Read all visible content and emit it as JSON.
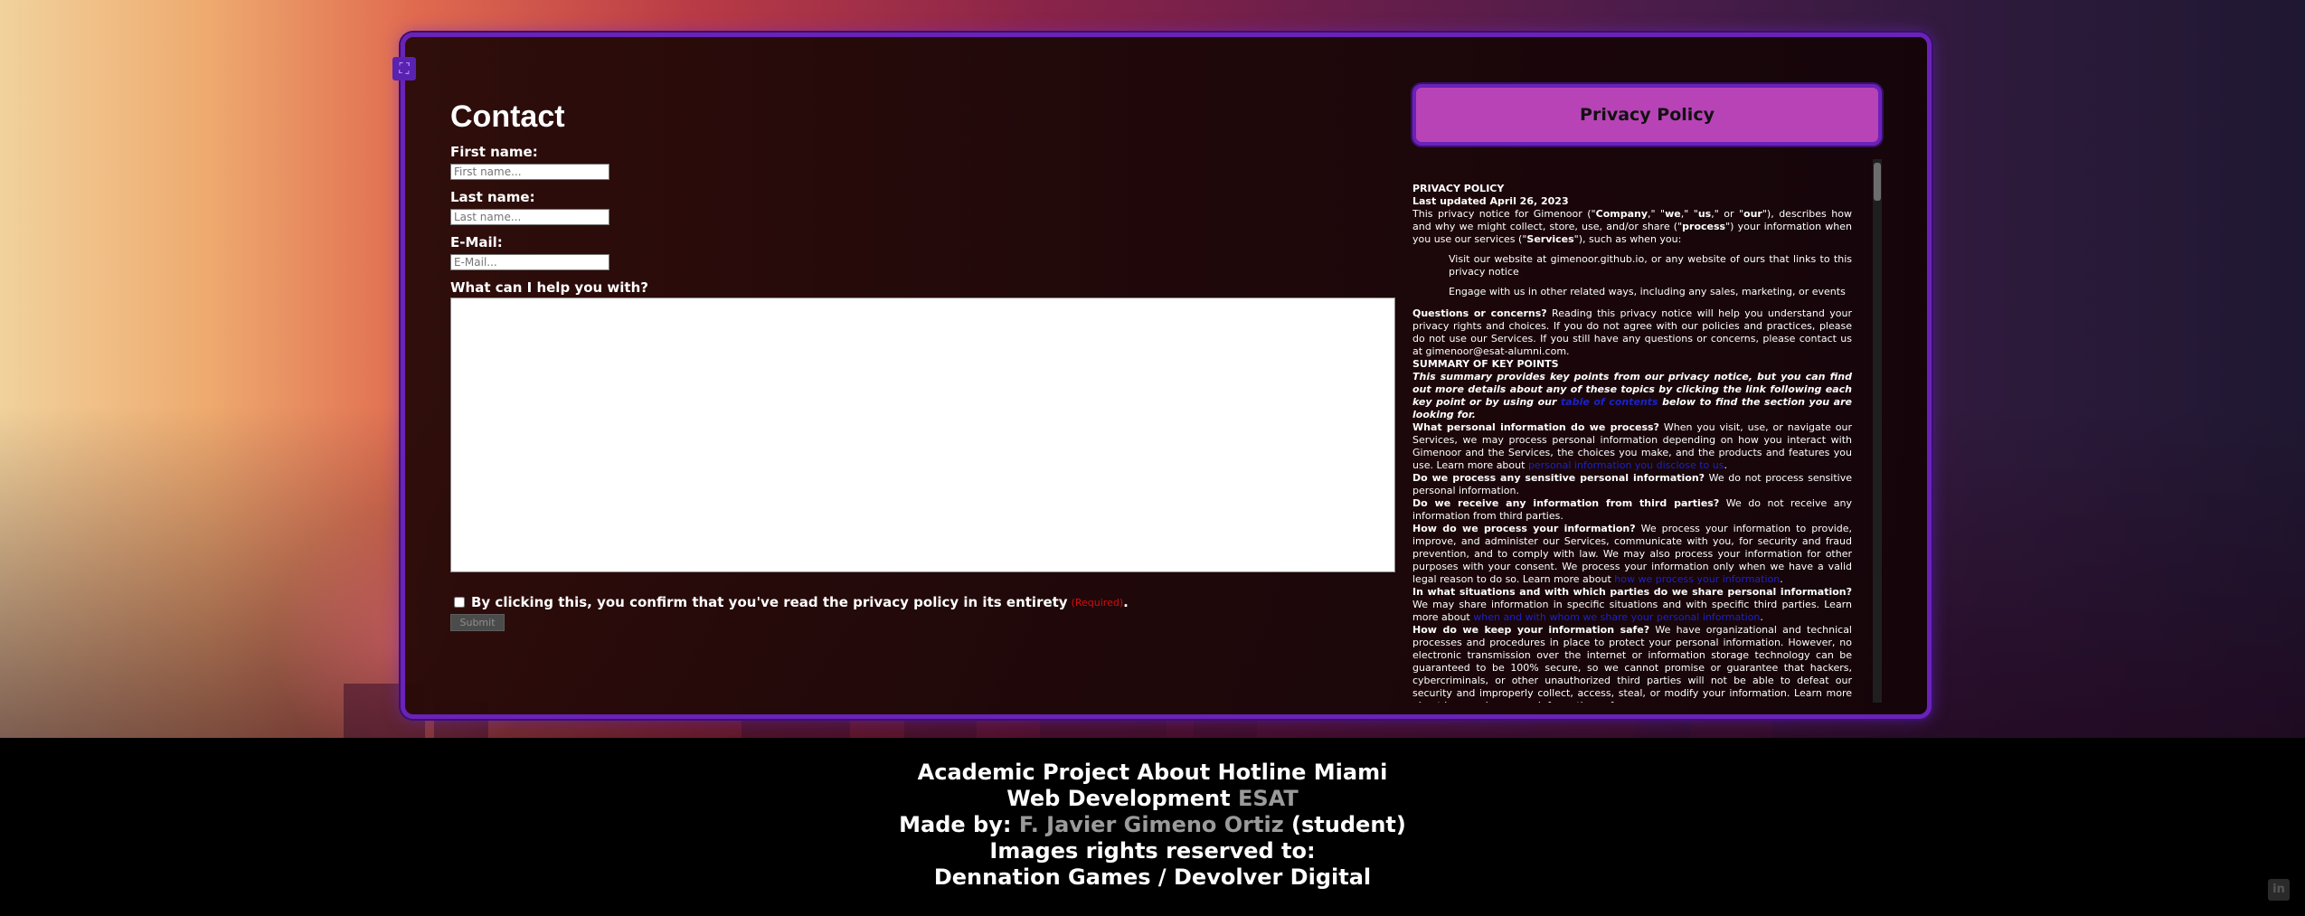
{
  "contact": {
    "title": "Contact",
    "first_name": {
      "label": "First name:",
      "placeholder": "First name..."
    },
    "last_name": {
      "label": "Last name:",
      "placeholder": "Last name..."
    },
    "email": {
      "label": "E-Mail:",
      "placeholder": "E-Mail..."
    },
    "message_label": "What can I help you with?",
    "consent_text": "By clicking this, you confirm that you've read the privacy policy in its entirety",
    "required": "(Required)",
    "consent_end": ".",
    "submit": "Submit"
  },
  "privacy": {
    "button": "Privacy Policy",
    "heading": "PRIVACY POLICY",
    "updated": "Last updated April 26, 2023",
    "intro_1": "This privacy notice for Gimenoor (\"",
    "intro_company": "Company",
    "intro_2": ",\" \"",
    "intro_we": "we",
    "intro_3": ",\" \"",
    "intro_us": "us",
    "intro_4": ",\" or \"",
    "intro_our": "our",
    "intro_5": "\"), describes how and why we might collect, store, use, and/or share (\"",
    "intro_process": "process",
    "intro_6": "\") your information when you use our services (\"",
    "intro_services": "Services",
    "intro_7": "\"), such as when you:",
    "item_1": "Visit our website at gimenoor.github.io, or any website of ours that links to this privacy notice",
    "item_2": "Engage with us in other related ways, including any sales, marketing, or events",
    "questions_bold": "Questions or concerns?",
    "questions_text": " Reading this privacy notice will help you understand your privacy rights and choices. If you do not agree with our policies and practices, please do not use our Services. If you still have any questions or concerns, please contact us at gimenoor@esat-alumni.com.",
    "summary_heading": "SUMMARY OF KEY POINTS",
    "summary_1": "This summary provides key points from our privacy notice, but you can find out more details about any of these topics by clicking the link following each key point or by using our ",
    "summary_link": "table of contents",
    "summary_2": " below to find the section you are looking for.",
    "q1_bold": "What personal information do we process?",
    "q1_text": " When you visit, use, or navigate our Services, we may process personal information depending on how you interact with Gimenoor and the Services, the choices you make, and the products and features you use. Learn more about ",
    "q1_link": "personal information you disclose to us",
    "q1_end": ".",
    "q2_bold": "Do we process any sensitive personal information?",
    "q2_text": " We do not process sensitive personal information.",
    "q3_bold": "Do we receive any information from third parties?",
    "q3_text": " We do not receive any information from third parties.",
    "q4_bold": "How do we process your information?",
    "q4_text": " We process your information to provide, improve, and administer our Services, communicate with you, for security and fraud prevention, and to comply with law. We may also process your information for other purposes with your consent. We process your information only when we have a valid legal reason to do so. Learn more about ",
    "q4_link": "how we process your information",
    "q4_end": ".",
    "q5_bold": "In what situations and with which parties do we share personal information?",
    "q5_text": " We may share information in specific situations and with specific third parties. Learn more about ",
    "q5_link": "when and with whom we share your personal information",
    "q5_end": ".",
    "q6_bold": "How do we keep your information safe?",
    "q6_text": " We have organizational and technical processes and procedures in place to protect your personal information. However, no electronic transmission over the internet or information storage technology can be guaranteed to be 100% secure, so we cannot promise or guarantee that hackers, cybercriminals, or other unauthorized third parties will not be able to defeat our security and improperly collect, access, steal, or modify your information. Learn more about how we keep your information safe."
  },
  "footer": {
    "line1": "Academic Project About Hotline Miami",
    "line2_a": "Web Development ",
    "line2_b": "ESAT",
    "line3_a": "Made by: ",
    "line3_b": "F. Javier Gimeno Ortiz",
    "line3_c": " (student)",
    "line4": "Images rights reserved to:",
    "line5": "Dennation Games / Devolver Digital"
  },
  "icons": {
    "corner": "fullscreen-icon",
    "social": "linkedin-icon"
  },
  "colors": {
    "panel_border": "#6a22b8",
    "privacy_button": "#b843b6",
    "required": "#d10f0f",
    "link": "#1a22c8"
  }
}
